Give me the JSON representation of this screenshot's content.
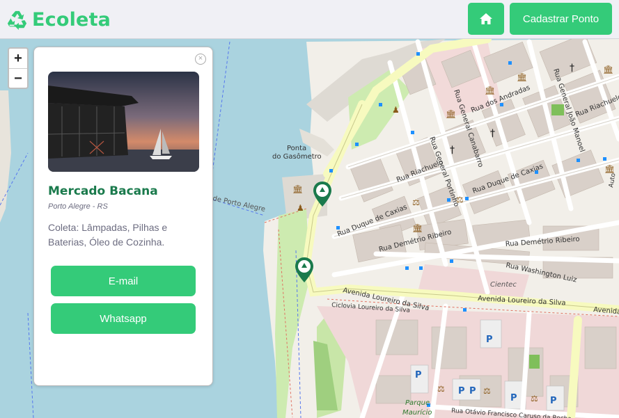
{
  "header": {
    "brand": "Ecoleta",
    "home_icon": "home-icon",
    "register_label": "Cadastrar Ponto"
  },
  "map": {
    "zoom_in": "+",
    "zoom_out": "−",
    "labels": {
      "ponta": "Ponta",
      "gasometro": "do Gasômetro",
      "porto_alegre_road": "de Porto Alegre",
      "andradas": "Rua dos Andradas",
      "canabarro": "Rua General Canabarro",
      "joao_manoel": "Rua General João Manoel",
      "riachuelo1": "Rua Riachuelo",
      "riachuelo2": "Rua Riachuelo",
      "riachuelo3": "Rua Riachuelo",
      "portinho": "Rua General Portinho",
      "duque1": "Rua Duque de Caxias",
      "duque2": "Rua Duque de Caxias",
      "demetrio1": "Rua Demétrio Ribeiro",
      "demetrio2": "Rua Demétrio Ribeiro",
      "washington": "Rua Washington Luiz",
      "cientec": "Cientec",
      "loureiro1": "Avenida Loureiro da Silva",
      "loureiro2": "Avenida Loureiro da Silva",
      "loureiro3": "Avenida",
      "ciclovia": "Ciclovia Loureiro da Silva",
      "parque": "Parque",
      "mauricio": "Maurício",
      "otavio": "Rua Otávio Francisco Caruso da Rocha",
      "auto": "Auto"
    }
  },
  "popup": {
    "close": "×",
    "name": "Mercado Bacana",
    "city": "Porto Alegre - RS",
    "items": "Coleta: Lâmpadas, Pilhas e Baterias, Óleo de Cozinha.",
    "email_label": "E-mail",
    "whatsapp_label": "Whatsapp"
  },
  "colors": {
    "primary": "#34cb79",
    "title": "#1a7a4c",
    "water": "#aad3df"
  }
}
